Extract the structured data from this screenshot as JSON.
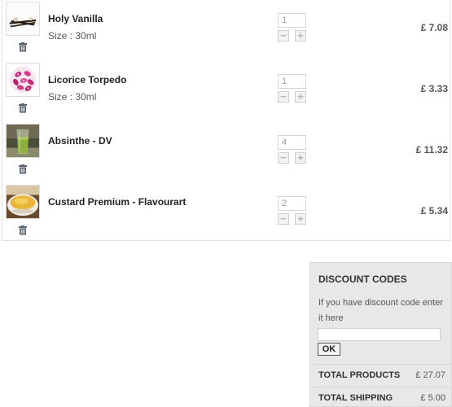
{
  "cart": {
    "items": [
      {
        "name": "Holy Vanilla",
        "size": "Size : 30ml",
        "quantity": "1",
        "price": "£ 7.08",
        "image_icon": "vanilla-pods"
      },
      {
        "name": "Licorice Torpedo",
        "size": "Size : 30ml",
        "quantity": "1",
        "price": "£ 3.33",
        "image_icon": "licorice-candies"
      },
      {
        "name": "Absinthe - DV",
        "size": "",
        "quantity": "4",
        "price": "£ 11.32",
        "image_icon": "absinthe-glass"
      },
      {
        "name": "Custard Premium - Flavourart",
        "size": "",
        "quantity": "2",
        "price": "£ 5.34",
        "image_icon": "custard-bowl"
      }
    ],
    "minus_label": "−",
    "plus_label": "+",
    "trash_icon": "trash-icon"
  },
  "summary": {
    "title": "DISCOUNT CODES",
    "hint": "If you have discount code enter it here",
    "code_value": "",
    "ok_label": "OK",
    "total_products_label": "TOTAL PRODUCTS",
    "total_products_value": "£ 27.07",
    "total_shipping_label": "TOTAL SHIPPING",
    "total_shipping_value": "£ 5.00"
  },
  "colors": {
    "panel_bg": "#e8e8e8",
    "border": "#e2e2e2",
    "qty_button_bg": "#f2f2f2"
  }
}
